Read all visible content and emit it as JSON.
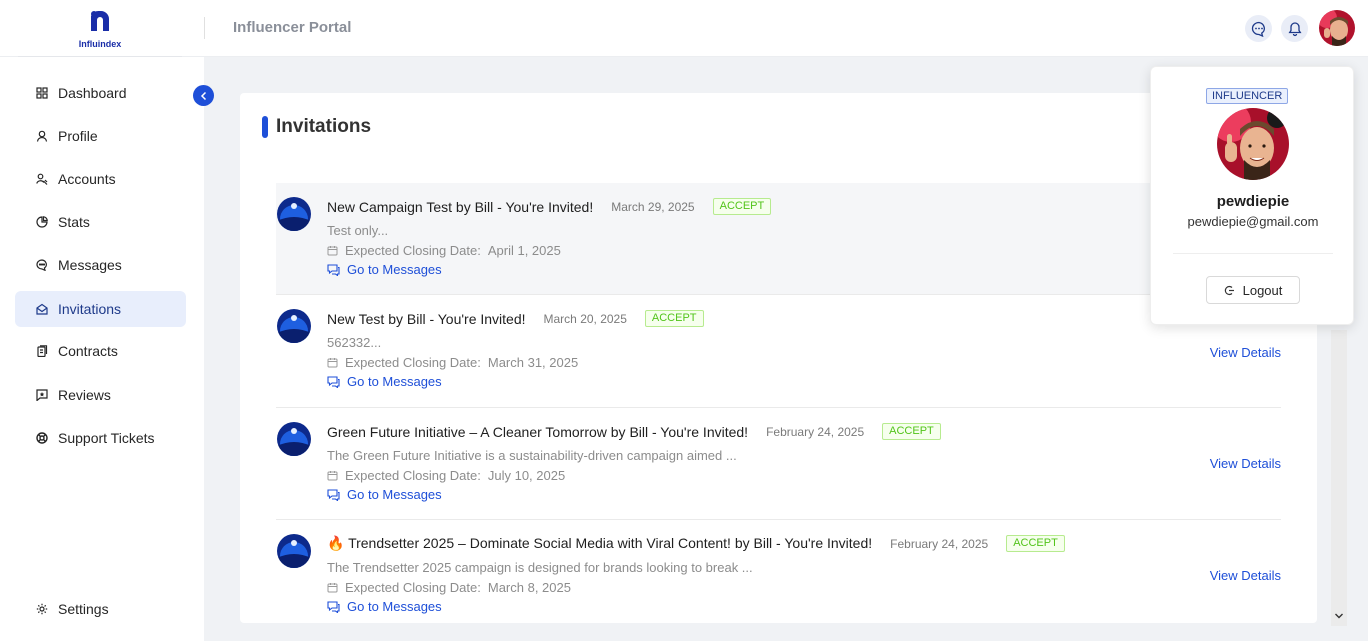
{
  "brand": {
    "logo_text": "Influindex"
  },
  "header": {
    "title": "Influencer Portal",
    "chat_icon": "chat-icon",
    "bell_icon": "bell-icon"
  },
  "sidebar": {
    "items": [
      {
        "label": "Dashboard",
        "icon": "grid-icon",
        "active": false
      },
      {
        "label": "Profile",
        "icon": "user-icon",
        "active": false
      },
      {
        "label": "Accounts",
        "icon": "accounts-icon",
        "active": false
      },
      {
        "label": "Stats",
        "icon": "pie-chart-icon",
        "active": false
      },
      {
        "label": "Messages",
        "icon": "message-icon",
        "active": false
      },
      {
        "label": "Invitations",
        "icon": "mail-icon",
        "active": true
      },
      {
        "label": "Contracts",
        "icon": "document-icon",
        "active": false
      },
      {
        "label": "Reviews",
        "icon": "review-icon",
        "active": false
      },
      {
        "label": "Support Tickets",
        "icon": "support-icon",
        "active": false
      }
    ],
    "settings_label": "Settings"
  },
  "main": {
    "title": "Invitations",
    "closing_label": "Expected Closing Date:",
    "messages_link": "Go to Messages",
    "view_details": "View Details",
    "invitations": [
      {
        "title": "New Campaign Test by Bill - You're Invited!",
        "date": "March 29, 2025",
        "status": "ACCEPT",
        "description": "Test only...",
        "closing_date": "April 1, 2025"
      },
      {
        "title": "New Test by Bill - You're Invited!",
        "date": "March 20, 2025",
        "status": "ACCEPT",
        "description": "562332...",
        "closing_date": "March 31, 2025"
      },
      {
        "title": "Green Future Initiative – A Cleaner Tomorrow by Bill - You're Invited!",
        "date": "February 24, 2025",
        "status": "ACCEPT",
        "description": "The Green Future Initiative is a sustainability-driven campaign aimed ...",
        "closing_date": "July 10, 2025"
      },
      {
        "title": "🔥 Trendsetter 2025 – Dominate Social Media with Viral Content! by Bill - You're Invited!",
        "date": "February 24, 2025",
        "status": "ACCEPT",
        "description": "The Trendsetter 2025 campaign is designed for brands looking to break ...",
        "closing_date": "March 8, 2025"
      }
    ]
  },
  "profile_menu": {
    "role": "INFLUENCER",
    "name": "pewdiepie",
    "email": "pewdiepie@gmail.com",
    "logout_label": "Logout"
  },
  "colors": {
    "accent": "#1e4fd8",
    "accept_green": "#52c41a",
    "muted": "#8c8c8c"
  }
}
